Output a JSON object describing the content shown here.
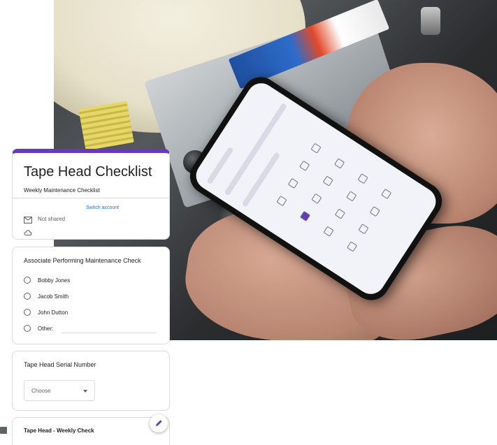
{
  "form": {
    "title": "Tape Head Checklist",
    "description": "Weekly Maintenance Checklist",
    "switch_account_label": "Switch account",
    "not_shared_label": "Not shared",
    "accent_color": "#673ab7",
    "questions": [
      {
        "title": "Associate Performing Maintenance Check",
        "type": "radio",
        "options": [
          "Bobby Jones",
          "Jacob Smith",
          "John Dutton",
          "Other:"
        ]
      },
      {
        "title": "Tape Head Serial Number",
        "type": "dropdown",
        "selected": "Choose"
      },
      {
        "title": "Tape Head - Weekly Check",
        "type": "section"
      }
    ]
  },
  "icons": {
    "not_shared": "mail-not-shared-icon",
    "cloud": "cloud-icon",
    "edit": "pencil-icon",
    "feedback": "feedback-icon"
  }
}
